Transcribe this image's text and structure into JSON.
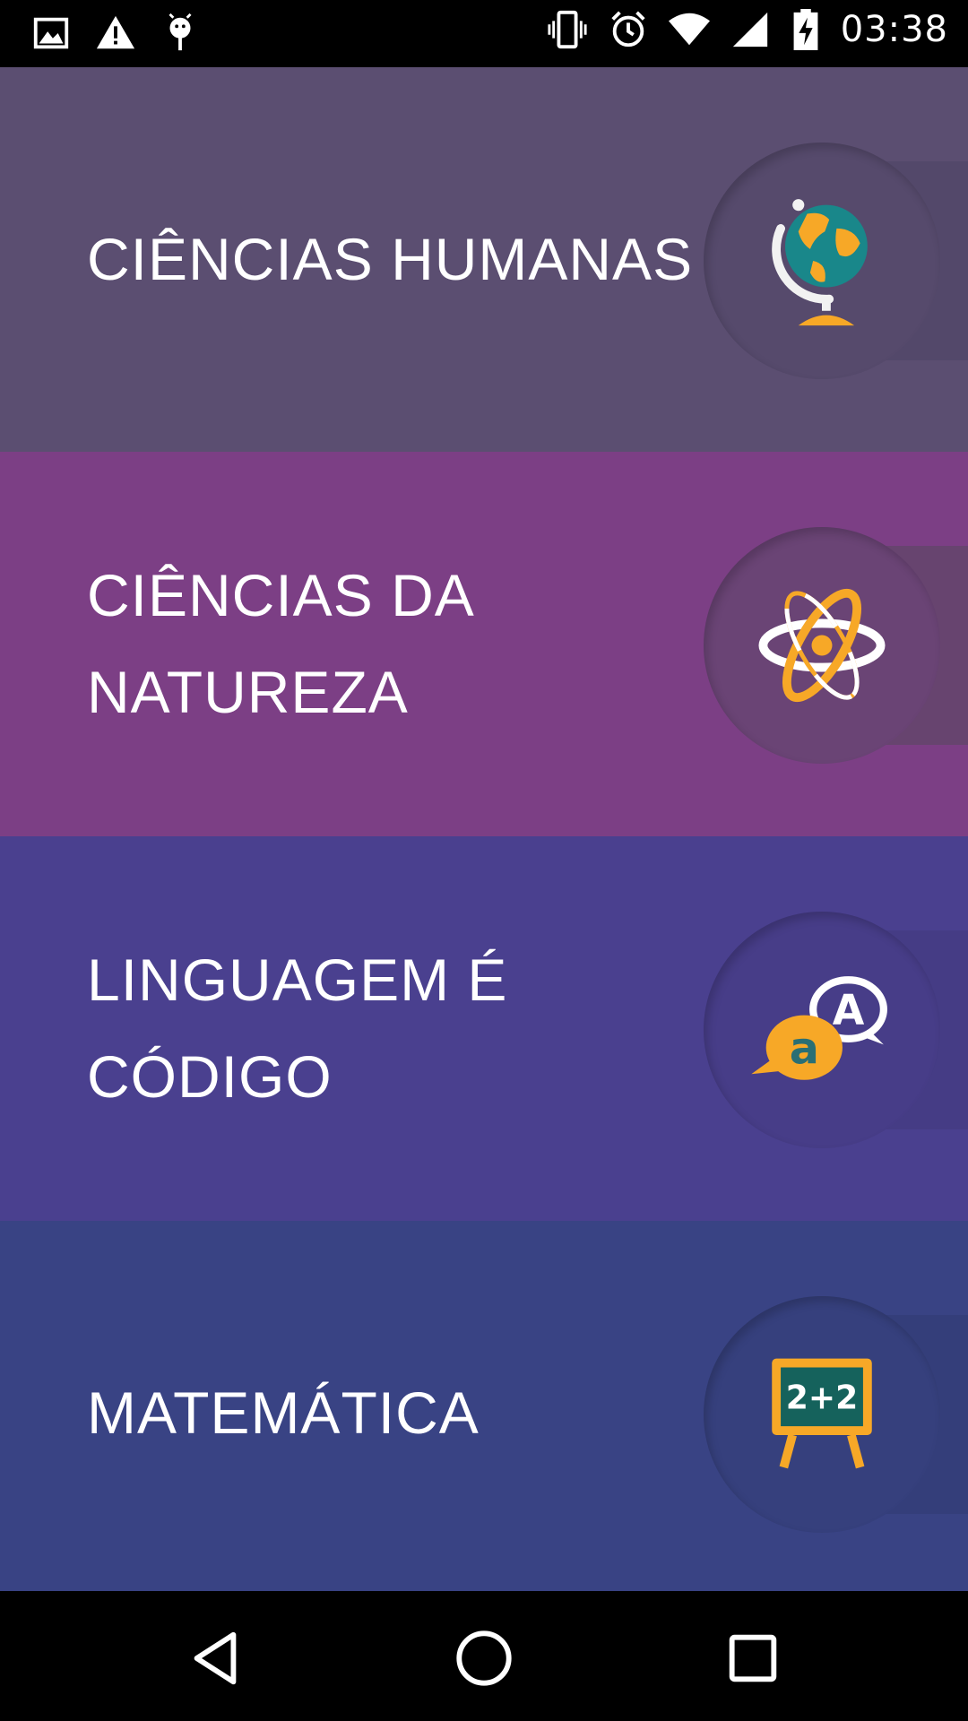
{
  "status_bar": {
    "time": "03:38",
    "left_icons": [
      "image-icon",
      "warning-icon",
      "android-icon"
    ],
    "right_icons": [
      "vibrate-icon",
      "alarm-icon",
      "wifi-icon",
      "signal-icon",
      "battery-charging-icon"
    ]
  },
  "categories": [
    {
      "label": "CIÊNCIAS HUMANAS",
      "icon": "globe-icon",
      "bg": "#5b4e71",
      "circle": "#564a6c",
      "tab": "#53486a"
    },
    {
      "label": "CIÊNCIAS DA\nNATUREZA",
      "icon": "atom-icon",
      "bg": "#7c3f85",
      "circle": "#6a4475",
      "tab": "#67446f"
    },
    {
      "label": "LINGUAGEM É\nCÓDIGO",
      "icon": "speech-bubbles-icon",
      "bg": "#4a408f",
      "circle": "#473d88",
      "tab": "#453c85"
    },
    {
      "label": "MATEMÁTICA",
      "icon": "chalkboard-icon",
      "bg": "#394384",
      "circle": "#36407d",
      "tab": "#343e7a"
    }
  ],
  "nav_bar": {
    "buttons": [
      "back-icon",
      "home-icon",
      "recents-icon"
    ]
  },
  "colors": {
    "accent_orange": "#f7a827",
    "globe_teal": "#19878a",
    "board_green": "#15625c"
  }
}
